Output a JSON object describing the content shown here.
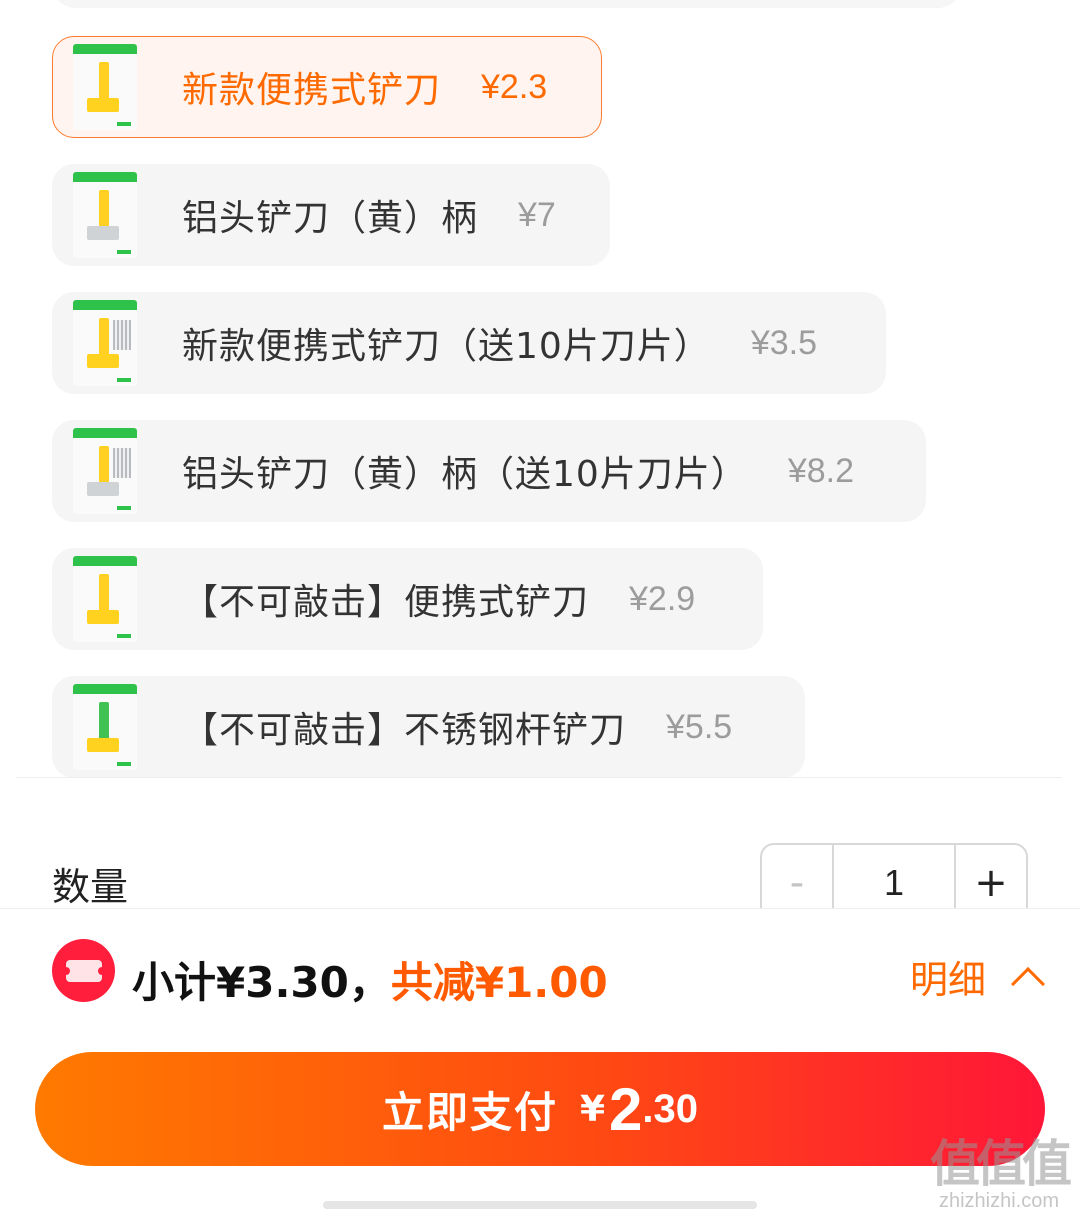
{
  "options": [
    {
      "name": "新款便携式铲刀",
      "price": "¥2.3",
      "selected": true
    },
    {
      "name": "铝头铲刀（黄）柄",
      "price": "¥7",
      "selected": false
    },
    {
      "name": "新款便携式铲刀（送10片刀片）",
      "price": "¥3.5",
      "selected": false
    },
    {
      "name": "铝头铲刀（黄）柄（送10片刀片）",
      "price": "¥8.2",
      "selected": false
    },
    {
      "name": "【不可敲击】便携式铲刀",
      "price": "¥2.9",
      "selected": false
    },
    {
      "name": "【不可敲击】不锈钢杆铲刀",
      "price": "¥5.5",
      "selected": false
    }
  ],
  "quantity": {
    "label": "数量",
    "minus": "-",
    "value": "1",
    "plus": "+"
  },
  "summary": {
    "subtotal": "小计¥3.30，",
    "discount": "共减¥1.00",
    "detail": "明细"
  },
  "pay": {
    "label": "立即支付",
    "currency": "¥",
    "amount_int": "2",
    "amount_dec": ".30"
  },
  "watermark": {
    "logo": "值值值",
    "site": "zhizhizhi.com"
  },
  "colors": {
    "accent": "#ff6a00",
    "pay_start": "#ff7a00",
    "pay_end": "#ff1638",
    "coupon": "#ff1f3d"
  },
  "icons": [
    "coupon-ticket-icon",
    "chevron-up-icon",
    "product-thumbnail"
  ]
}
